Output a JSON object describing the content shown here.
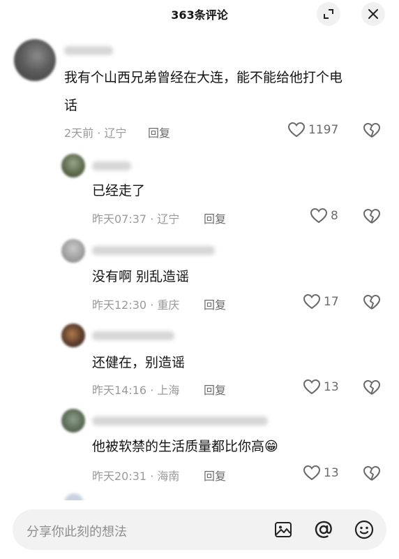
{
  "header": {
    "title": "363条评论",
    "expand_icon": "expand-icon",
    "close_icon": "close-icon"
  },
  "comments": [
    {
      "text_line1": "我有个山西兄弟曾经在大连，能不能给他打个电",
      "text_line2": "话",
      "meta": "2天前 · 辽宁",
      "reply": "回复",
      "likes": "1197"
    },
    {
      "text": "已经走了",
      "meta": "昨天07:37 · 辽宁",
      "reply": "回复",
      "likes": "8"
    },
    {
      "text": "没有啊 别乱造谣",
      "meta": "昨天12:30 · 重庆",
      "reply": "回复",
      "likes": "17"
    },
    {
      "text": "还健在，别造谣",
      "meta": "昨天14:16 · 上海",
      "reply": "回复",
      "likes": "13"
    },
    {
      "text": "他被软禁的生活质量都比你高😁",
      "meta": "昨天20:31 · 海南",
      "reply": "回复",
      "likes": "13"
    }
  ],
  "composer": {
    "placeholder": "分享你此刻的想法",
    "icons": [
      "image-icon",
      "mention-icon",
      "emoji-icon"
    ]
  }
}
